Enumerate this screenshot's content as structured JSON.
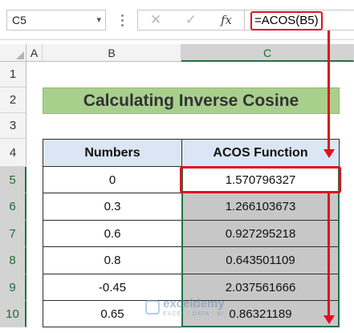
{
  "formula_bar": {
    "name_box": "C5",
    "cancel_icon": "✕",
    "enter_icon": "✓",
    "fx_label": "fx",
    "formula": "=ACOS(B5)"
  },
  "columns": [
    "A",
    "B",
    "C"
  ],
  "selected_column": "C",
  "rows": [
    "1",
    "2",
    "3",
    "4",
    "5",
    "6",
    "7",
    "8",
    "9",
    "10"
  ],
  "selected_rows": [
    "5",
    "6",
    "7",
    "8",
    "9",
    "10"
  ],
  "title": "Calculating Inverse Cosine",
  "table": {
    "headers": [
      "Numbers",
      "ACOS Function"
    ],
    "rows": [
      [
        "0",
        "1.570796327"
      ],
      [
        "0.3",
        "1.266103673"
      ],
      [
        "0.6",
        "0.927295218"
      ],
      [
        "0.8",
        "0.643501109"
      ],
      [
        "-0.45",
        "2.037561666"
      ],
      [
        "0.65",
        "0.86321189"
      ]
    ]
  },
  "watermark": {
    "name": "exceldemy",
    "tagline": "EXCEL · DATA · BI"
  },
  "colors": {
    "title_bg": "#a9cf8d",
    "header_bg": "#dbe6f4",
    "selection_fill": "#c7c7c7",
    "selection_border": "#217346",
    "annotation_red": "#e0101e"
  }
}
